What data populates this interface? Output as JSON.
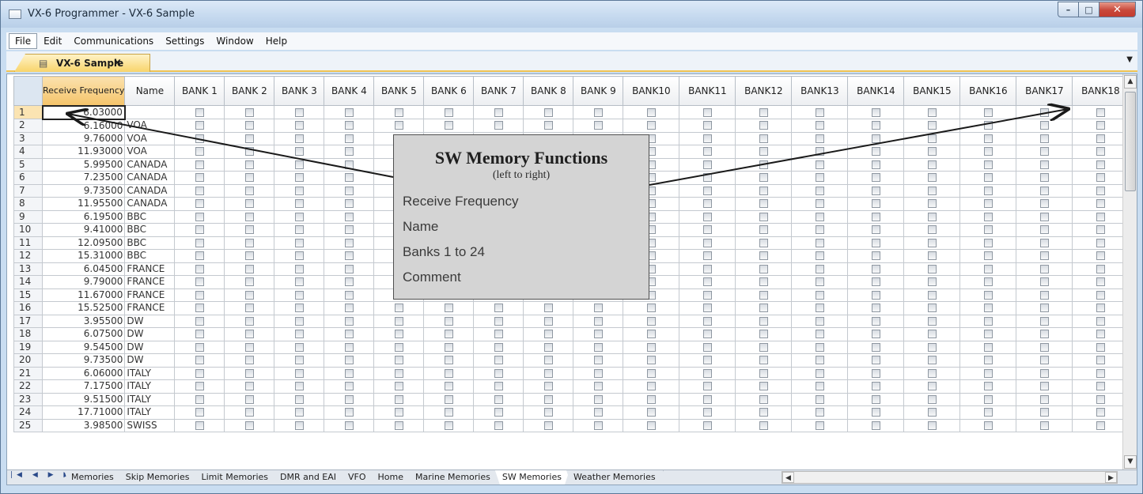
{
  "window": {
    "title": "VX-6 Programmer - VX-6 Sample"
  },
  "caption": {
    "minimize": "–",
    "maximize": "□",
    "close": "✕"
  },
  "menu": [
    "File",
    "Edit",
    "Communications",
    "Settings",
    "Window",
    "Help"
  ],
  "doc_tab": {
    "label": "VX-6 Sample",
    "close": "×",
    "dropdown": "▼"
  },
  "grid": {
    "headers": {
      "freq": "Receive Frequency",
      "name": "Name",
      "banks": [
        "BANK 1",
        "BANK 2",
        "BANK 3",
        "BANK 4",
        "BANK 5",
        "BANK 6",
        "BANK 7",
        "BANK 8",
        "BANK 9",
        "BANK10",
        "BANK11",
        "BANK12",
        "BANK13",
        "BANK14",
        "BANK15",
        "BANK16",
        "BANK17",
        "BANK18"
      ]
    },
    "rows": [
      {
        "num": "1",
        "freq": "6.03000",
        "name": ""
      },
      {
        "num": "2",
        "freq": "6.16000",
        "name": "VOA"
      },
      {
        "num": "3",
        "freq": "9.76000",
        "name": "VOA"
      },
      {
        "num": "4",
        "freq": "11.93000",
        "name": "VOA"
      },
      {
        "num": "5",
        "freq": "5.99500",
        "name": "CANADA"
      },
      {
        "num": "6",
        "freq": "7.23500",
        "name": "CANADA"
      },
      {
        "num": "7",
        "freq": "9.73500",
        "name": "CANADA"
      },
      {
        "num": "8",
        "freq": "11.95500",
        "name": "CANADA"
      },
      {
        "num": "9",
        "freq": "6.19500",
        "name": "BBC"
      },
      {
        "num": "10",
        "freq": "9.41000",
        "name": "BBC"
      },
      {
        "num": "11",
        "freq": "12.09500",
        "name": "BBC"
      },
      {
        "num": "12",
        "freq": "15.31000",
        "name": "BBC"
      },
      {
        "num": "13",
        "freq": "6.04500",
        "name": "FRANCE"
      },
      {
        "num": "14",
        "freq": "9.79000",
        "name": "FRANCE"
      },
      {
        "num": "15",
        "freq": "11.67000",
        "name": "FRANCE"
      },
      {
        "num": "16",
        "freq": "15.52500",
        "name": "FRANCE"
      },
      {
        "num": "17",
        "freq": "3.95500",
        "name": "DW"
      },
      {
        "num": "18",
        "freq": "6.07500",
        "name": "DW"
      },
      {
        "num": "19",
        "freq": "9.54500",
        "name": "DW"
      },
      {
        "num": "20",
        "freq": "9.73500",
        "name": "DW"
      },
      {
        "num": "21",
        "freq": "6.06000",
        "name": "ITALY"
      },
      {
        "num": "22",
        "freq": "7.17500",
        "name": "ITALY"
      },
      {
        "num": "23",
        "freq": "9.51500",
        "name": "ITALY"
      },
      {
        "num": "24",
        "freq": "17.71000",
        "name": "ITALY"
      },
      {
        "num": "25",
        "freq": "3.98500",
        "name": "SWISS"
      }
    ]
  },
  "sheet_nav": "|◀ ◀ ▶ ▶|",
  "sheets": [
    "Memories",
    "Skip Memories",
    "Limit Memories",
    "DMR and EAI",
    "VFO",
    "Home",
    "Marine Memories",
    "SW Memories",
    "Weather Memories"
  ],
  "active_sheet": "SW Memories",
  "scroll_glyphs": {
    "up": "▲",
    "down": "▼",
    "left": "◀",
    "right": "▶"
  },
  "callout": {
    "title": "SW Memory Functions",
    "subtitle": "(left to right)",
    "lines": [
      "Receive Frequency",
      "Name",
      "Banks 1 to 24",
      "Comment"
    ]
  },
  "colors": {
    "tab_accent": "#f1c453",
    "selected_header": "#f5c46a",
    "callout_bg": "#d4d4d4"
  }
}
